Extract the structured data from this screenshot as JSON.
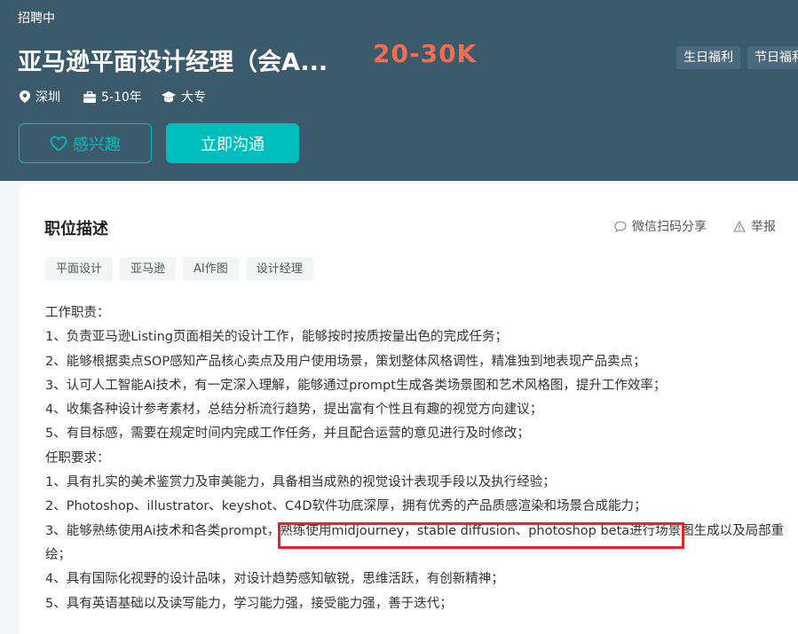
{
  "header": {
    "status": "招聘中",
    "job_title": "亚马逊平面设计经理（会A...",
    "salary": "20-30K",
    "welfare": [
      "生日福利",
      "节日福利"
    ],
    "location": "深圳",
    "experience": "5-10年",
    "education": "大专",
    "interest_label": "感兴趣",
    "chat_label": "立即沟通",
    "colors": {
      "header_bg": "#3b5a6c",
      "accent": "#00bebd",
      "salary": "#f26d50",
      "highlight": "#e0252b"
    }
  },
  "card": {
    "title": "职位描述",
    "share_label": "微信扫码分享",
    "report_label": "举报",
    "tags": [
      "平面设计",
      "亚马逊",
      "AI作图",
      "设计经理"
    ],
    "description": [
      "工作职责：",
      "1、负责亚马逊Listing页面相关的设计工作，能够按时按质按量出色的完成任务；",
      "2、能够根据卖点SOP感知产品核心卖点及用户使用场景，策划整体风格调性，精准独到地表现产品卖点；",
      "3、认可人工智能Ai技术，有一定深入理解，能够通过prompt生成各类场景图和艺术风格图，提升工作效率；",
      "4、收集各种设计参考素材，总结分析流行趋势，提出富有个性且有趣的视觉方向建议；",
      "5、有目标感，需要在规定时间内完成工作任务，并且配合运营的意见进行及时修改；",
      "任职要求：",
      "1、具有扎实的美术鉴赏力及审美能力，具备相当成熟的视觉设计表现手段以及执行经验；",
      "2、Photoshop、illustrator、keyshot、C4D软件功底深厚，拥有优秀的产品质感渲染和场景合成能力；",
      "3、能够熟练使用Ai技术和各类prompt，熟练使用midjourney，stable diffusion、photoshop beta进行场景图生成以及局部重",
      "绘；",
      "4、具有国际化视野的设计品味，对设计趋势感知敏锐，思维活跃，有创新精神；",
      "5、具有英语基础以及读写能力，学习能力强，接受能力强，善于迭代；"
    ]
  },
  "icons": {
    "location": "location-pin-icon",
    "experience": "briefcase-icon",
    "education": "graduation-cap-icon",
    "interest": "heart-icon",
    "share": "chat-bubble-icon",
    "report": "warning-triangle-icon"
  }
}
